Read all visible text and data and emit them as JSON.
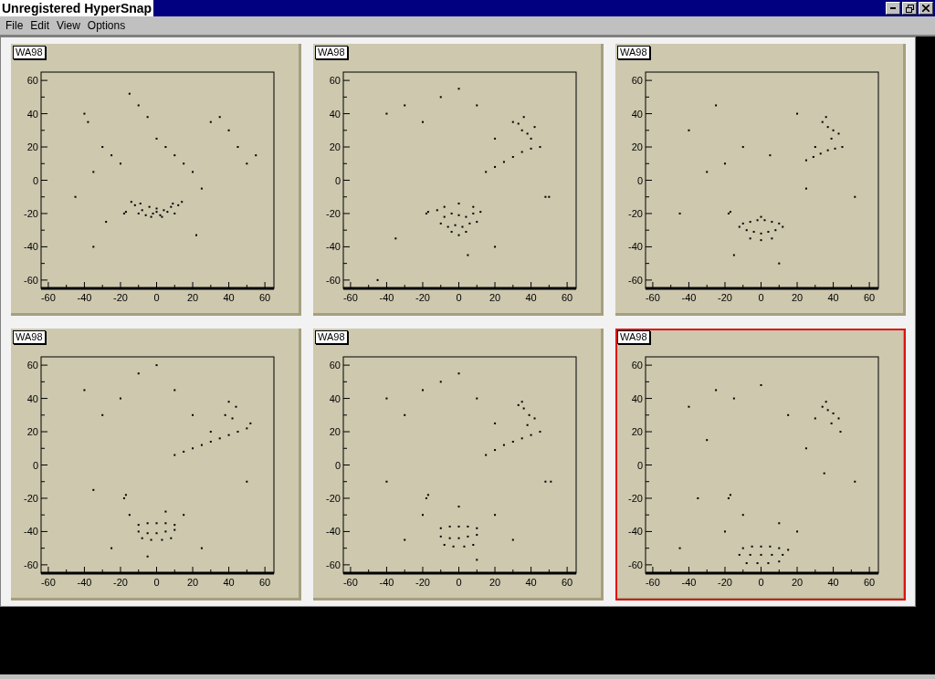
{
  "window": {
    "title": "Unregistered HyperSnap"
  },
  "menu": [
    "File",
    "Edit",
    "View",
    "Options"
  ],
  "panels": [
    {
      "label": "WA98",
      "selected": false,
      "chart_data": {
        "type": "scatter",
        "xlim": [
          -64,
          65
        ],
        "ylim": [
          -65,
          65
        ],
        "xticks": [
          -60,
          -40,
          -20,
          0,
          20,
          40,
          60
        ],
        "yticks": [
          -60,
          -40,
          -20,
          0,
          20,
          40,
          60
        ],
        "x": [
          -40,
          -38,
          -30,
          -25,
          -20,
          -15,
          -10,
          -5,
          0,
          5,
          10,
          15,
          20,
          25,
          30,
          35,
          40,
          45,
          50,
          55,
          -45,
          -35,
          -18,
          -17,
          -12,
          -8,
          -4,
          0,
          4,
          8,
          12,
          -10,
          -6,
          -2,
          2,
          6,
          10,
          22,
          -35,
          -28,
          -14,
          14,
          -9,
          9,
          0,
          -3,
          3
        ],
        "series": [
          {
            "color": "#000000",
            "values": [
              40,
              35,
              20,
              15,
              10,
              52,
              45,
              38,
              25,
              20,
              15,
              10,
              5,
              -5,
              35,
              38,
              30,
              20,
              10,
              15,
              -10,
              -40,
              -20,
              -19,
              -15,
              -18,
              -16,
              -17,
              -18,
              -16,
              -15,
              -20,
              -21,
              -20,
              -21,
              -19,
              -20,
              -33,
              5,
              -25,
              -13,
              -13,
              -14,
              -14,
              -19,
              -22,
              -22
            ]
          }
        ]
      }
    },
    {
      "label": "WA98",
      "selected": false,
      "chart_data": {
        "type": "scatter",
        "xlim": [
          -64,
          65
        ],
        "ylim": [
          -65,
          65
        ],
        "xticks": [
          -60,
          -40,
          -20,
          0,
          20,
          40,
          60
        ],
        "yticks": [
          -60,
          -40,
          -20,
          0,
          20,
          40,
          60
        ],
        "x": [
          -40,
          -30,
          -20,
          -10,
          0,
          10,
          20,
          30,
          35,
          38,
          40,
          42,
          36,
          33,
          15,
          20,
          25,
          30,
          35,
          40,
          45,
          -18,
          -17,
          -12,
          -8,
          -4,
          0,
          4,
          8,
          12,
          -10,
          -6,
          -2,
          2,
          6,
          10,
          50,
          48,
          -35,
          20,
          -45,
          0,
          5,
          -8,
          8,
          -4,
          4,
          0
        ],
        "series": [
          {
            "color": "#000000",
            "values": [
              40,
              45,
              35,
              50,
              55,
              45,
              25,
              35,
              30,
              28,
              25,
              32,
              38,
              34,
              5,
              8,
              11,
              14,
              17,
              19,
              20,
              -20,
              -19,
              -18,
              -22,
              -20,
              -21,
              -22,
              -20,
              -19,
              -26,
              -28,
              -27,
              -28,
              -26,
              -25,
              -10,
              -10,
              -35,
              -40,
              -60,
              -33,
              -45,
              -16,
              -16,
              -31,
              -31,
              -14
            ]
          }
        ]
      }
    },
    {
      "label": "WA98",
      "selected": false,
      "chart_data": {
        "type": "scatter",
        "xlim": [
          -64,
          65
        ],
        "ylim": [
          -65,
          65
        ],
        "xticks": [
          -60,
          -40,
          -20,
          0,
          20,
          40,
          60
        ],
        "yticks": [
          -60,
          -40,
          -20,
          0,
          20,
          40,
          60
        ],
        "x": [
          -40,
          -25,
          -10,
          5,
          20,
          30,
          34,
          37,
          40,
          43,
          36,
          39,
          25,
          29,
          33,
          37,
          41,
          45,
          -18,
          -17,
          -10,
          -6,
          -2,
          2,
          6,
          10,
          -8,
          -4,
          0,
          4,
          8,
          -6,
          0,
          6,
          52,
          -30,
          -15,
          10,
          -45,
          25,
          -20,
          -12,
          12,
          0
        ],
        "series": [
          {
            "color": "#000000",
            "values": [
              30,
              45,
              20,
              15,
              40,
              20,
              35,
              32,
              30,
              28,
              38,
              25,
              12,
              14,
              16,
              18,
              19,
              20,
              -20,
              -19,
              -26,
              -25,
              -24,
              -24,
              -25,
              -26,
              -30,
              -31,
              -32,
              -31,
              -30,
              -35,
              -36,
              -35,
              -10,
              5,
              -45,
              -50,
              -20,
              -5,
              10,
              -28,
              -28,
              -22
            ]
          }
        ]
      }
    },
    {
      "label": "WA98",
      "selected": false,
      "chart_data": {
        "type": "scatter",
        "xlim": [
          -64,
          65
        ],
        "ylim": [
          -65,
          65
        ],
        "xticks": [
          -60,
          -40,
          -20,
          0,
          20,
          40,
          60
        ],
        "yticks": [
          -60,
          -40,
          -20,
          0,
          20,
          40,
          60
        ],
        "x": [
          -40,
          -30,
          -20,
          -10,
          0,
          10,
          20,
          30,
          40,
          44,
          38,
          42,
          10,
          15,
          20,
          25,
          30,
          35,
          40,
          45,
          50,
          52,
          -18,
          -17,
          -10,
          -5,
          0,
          5,
          10,
          -10,
          -5,
          0,
          5,
          10,
          -8,
          -3,
          3,
          8,
          -15,
          15,
          -25,
          25,
          50,
          -35,
          -5,
          5
        ],
        "series": [
          {
            "color": "#000000",
            "values": [
              45,
              30,
              40,
              55,
              60,
              45,
              30,
              20,
              38,
              35,
              30,
              28,
              6,
              8,
              10,
              12,
              14,
              16,
              18,
              20,
              22,
              25,
              -20,
              -18,
              -36,
              -35,
              -35,
              -35,
              -36,
              -40,
              -41,
              -41,
              -40,
              -39,
              -44,
              -45,
              -45,
              -44,
              -30,
              -30,
              -50,
              -50,
              -10,
              -15,
              -55,
              -28
            ]
          }
        ]
      }
    },
    {
      "label": "WA98",
      "selected": false,
      "chart_data": {
        "type": "scatter",
        "xlim": [
          -64,
          65
        ],
        "ylim": [
          -65,
          65
        ],
        "xticks": [
          -60,
          -40,
          -20,
          0,
          20,
          40,
          60
        ],
        "yticks": [
          -60,
          -40,
          -20,
          0,
          20,
          40,
          60
        ],
        "x": [
          -40,
          -30,
          -20,
          -10,
          0,
          10,
          20,
          33,
          36,
          39,
          42,
          35,
          38,
          15,
          20,
          25,
          30,
          35,
          40,
          45,
          48,
          51,
          -18,
          -17,
          -10,
          -5,
          0,
          5,
          10,
          -10,
          -5,
          0,
          5,
          10,
          -8,
          -3,
          3,
          8,
          -20,
          20,
          -30,
          30,
          -40,
          0,
          10
        ],
        "series": [
          {
            "color": "#000000",
            "values": [
              40,
              30,
              45,
              50,
              55,
              40,
              25,
              36,
              34,
              30,
              28,
              38,
              24,
              6,
              9,
              12,
              14,
              16,
              18,
              20,
              -10,
              -10,
              -20,
              -18,
              -38,
              -37,
              -37,
              -37,
              -38,
              -43,
              -44,
              -44,
              -43,
              -42,
              -48,
              -49,
              -49,
              -48,
              -30,
              -30,
              -45,
              -45,
              -10,
              -25,
              -57
            ]
          }
        ]
      }
    },
    {
      "label": "WA98",
      "selected": true,
      "chart_data": {
        "type": "scatter",
        "xlim": [
          -64,
          65
        ],
        "ylim": [
          -65,
          65
        ],
        "xticks": [
          -60,
          -40,
          -20,
          0,
          20,
          40,
          60
        ],
        "yticks": [
          -60,
          -40,
          -20,
          0,
          20,
          40,
          60
        ],
        "x": [
          -40,
          -25,
          -15,
          0,
          15,
          30,
          34,
          37,
          40,
          43,
          36,
          39,
          44,
          52,
          -18,
          -17,
          -10,
          -5,
          0,
          5,
          10,
          15,
          -12,
          -6,
          0,
          6,
          12,
          -8,
          -2,
          4,
          10,
          -20,
          20,
          -35,
          35,
          -45,
          25,
          -30,
          10,
          -10
        ],
        "series": [
          {
            "color": "#000000",
            "values": [
              35,
              45,
              40,
              48,
              30,
              28,
              35,
              33,
              31,
              28,
              38,
              25,
              20,
              -10,
              -20,
              -18,
              -50,
              -49,
              -49,
              -49,
              -50,
              -51,
              -54,
              -54,
              -54,
              -54,
              -54,
              -59,
              -59,
              -59,
              -58,
              -40,
              -40,
              -20,
              -5,
              -50,
              10,
              15,
              -35,
              -30
            ]
          }
        ]
      }
    }
  ]
}
